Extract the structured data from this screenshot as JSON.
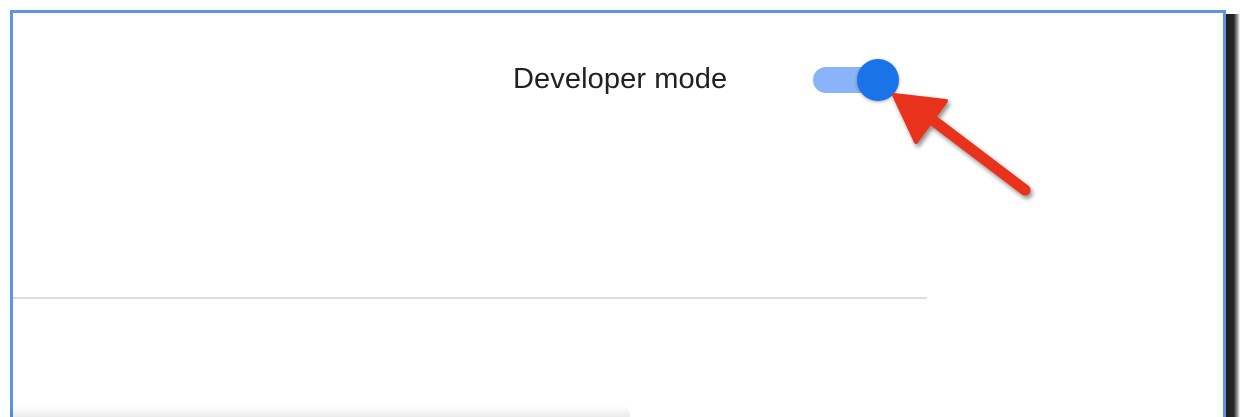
{
  "settings_header": {
    "developer_mode_label": "Developer mode",
    "developer_mode_enabled": true
  },
  "colors": {
    "frame_border": "#5b95e8",
    "toggle_track": "#8ab4f8",
    "toggle_knob": "#1a73e8",
    "annotation_arrow": "#e8321f",
    "divider": "#dadce0"
  },
  "annotation": {
    "icon": "red-arrow-icon"
  }
}
